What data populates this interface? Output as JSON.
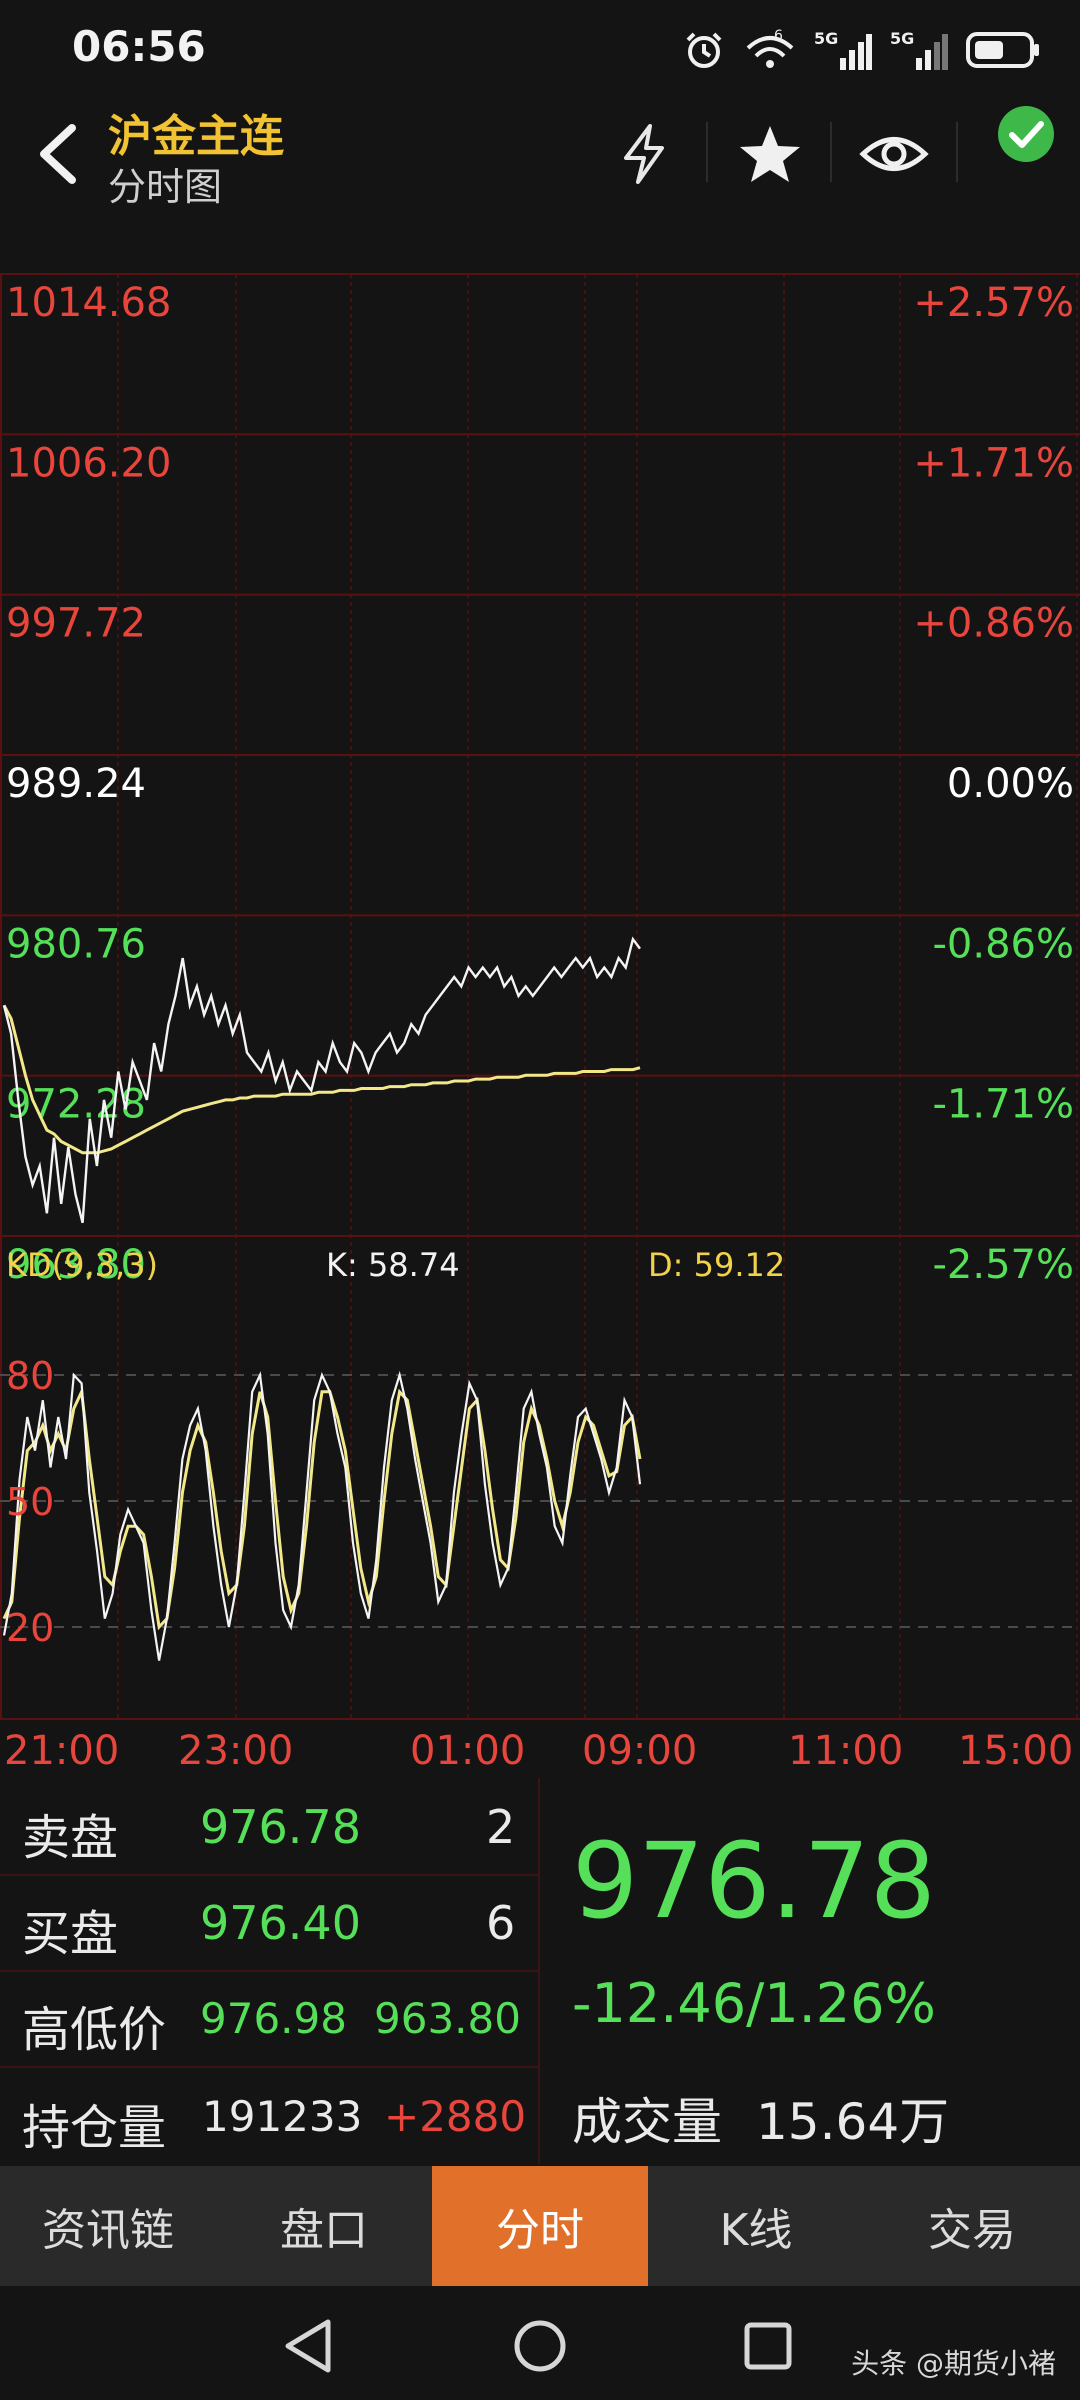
{
  "status_bar": {
    "time": "06:56",
    "icons": [
      "alarm-icon",
      "wifi-icon",
      "signal-5g-icon",
      "signal-5g-icon",
      "battery-icon"
    ],
    "signal_labels": [
      "5G",
      "5G"
    ],
    "wifi_label": "6"
  },
  "header": {
    "title": "沪金主连",
    "subtitle": "分时图",
    "buttons": [
      "flash-icon",
      "star-icon",
      "eye-icon",
      "check-icon"
    ]
  },
  "price_axis": {
    "left_labels": [
      "1014.68",
      "1006.20",
      "997.72",
      "989.24",
      "980.76",
      "972.28",
      "963.80"
    ],
    "right_labels": [
      "+2.57%",
      "+1.71%",
      "+0.86%",
      "0.00%",
      "-0.86%",
      "-1.71%",
      "-2.57%"
    ],
    "colors": {
      "up": "#e8463c",
      "flat": "#ffffff",
      "down": "#56e05a"
    }
  },
  "kd_indicator": {
    "label": "KD(9,3,3)",
    "k_text": "K: 58.74",
    "d_text": "D: 59.12",
    "levels": [
      "80",
      "50",
      "20"
    ]
  },
  "time_axis": [
    "21:00",
    "23:00",
    "01:00",
    "09:00",
    "11:00",
    "15:00"
  ],
  "chart_data": {
    "type": "line",
    "ylim": [
      963.8,
      1014.68
    ],
    "series": [
      {
        "values": [
          976.0,
          974.5,
          971.0,
          968.0,
          966.5,
          967.5,
          965.0,
          969.0,
          965.5,
          968.5,
          966.0,
          964.5,
          970.0,
          967.5,
          971.0,
          969.0,
          972.5,
          970.5,
          973.0,
          972.0,
          971.0,
          974.0,
          972.5,
          975.0,
          976.5,
          978.5,
          976.0,
          977.0,
          975.5,
          976.5,
          975.0,
          976.0,
          974.5,
          975.5,
          973.5,
          973.0,
          972.5,
          973.5,
          972.0,
          973.0,
          971.5,
          972.5,
          972.0,
          971.5,
          973.0,
          972.5,
          974.0,
          973.0,
          972.5,
          974.0,
          973.5,
          972.5,
          973.5,
          974.0,
          974.5,
          973.5,
          974.0,
          975.0,
          974.5,
          975.5,
          976.0,
          976.5,
          977.0,
          977.5,
          977.0,
          978.0,
          977.5,
          978.0,
          977.5,
          978.0,
          977.0,
          977.5,
          976.5,
          977.0,
          976.5,
          977.0,
          977.5,
          978.0,
          977.5,
          978.0,
          978.5,
          978.0,
          978.5,
          977.5,
          978.0,
          977.5,
          978.5,
          978.0,
          979.5,
          979.0
        ]
      },
      {
        "values": [
          976.0,
          975.3,
          973.8,
          972.3,
          971.0,
          970.2,
          969.4,
          969.2,
          968.8,
          968.6,
          968.4,
          968.2,
          968.2,
          968.2,
          968.3,
          968.4,
          968.6,
          968.8,
          969.0,
          969.2,
          969.4,
          969.6,
          969.8,
          970.0,
          970.2,
          970.4,
          970.5,
          970.6,
          970.7,
          970.8,
          970.9,
          971.0,
          971.0,
          971.1,
          971.1,
          971.2,
          971.2,
          971.2,
          971.2,
          971.3,
          971.3,
          971.3,
          971.3,
          971.3,
          971.4,
          971.4,
          971.4,
          971.5,
          971.5,
          971.5,
          971.6,
          971.6,
          971.6,
          971.6,
          971.7,
          971.7,
          971.7,
          971.8,
          971.8,
          971.8,
          971.9,
          971.9,
          971.9,
          972.0,
          972.0,
          972.0,
          972.1,
          972.1,
          972.1,
          972.2,
          972.2,
          972.2,
          972.2,
          972.3,
          972.3,
          972.3,
          972.3,
          972.4,
          972.4,
          972.4,
          972.4,
          972.5,
          972.5,
          972.5,
          972.5,
          972.6,
          972.6,
          972.6,
          972.6,
          972.7
        ]
      }
    ]
  },
  "kd_data": {
    "k": [
      18,
      28,
      55,
      70,
      62,
      74,
      58,
      70,
      60,
      80,
      78,
      52,
      38,
      22,
      28,
      42,
      48,
      44,
      40,
      24,
      12,
      22,
      40,
      60,
      68,
      72,
      62,
      44,
      30,
      20,
      30,
      52,
      76,
      80,
      66,
      40,
      24,
      20,
      30,
      52,
      74,
      80,
      76,
      66,
      58,
      40,
      28,
      22,
      36,
      58,
      74,
      80,
      72,
      60,
      50,
      40,
      26,
      30,
      52,
      66,
      78,
      74,
      54,
      40,
      30,
      34,
      52,
      72,
      76,
      66,
      58,
      44,
      40,
      56,
      70,
      72,
      66,
      60,
      52,
      58,
      74,
      70,
      54
    ],
    "d": [
      22,
      26,
      46,
      62,
      64,
      68,
      62,
      66,
      62,
      72,
      76,
      60,
      46,
      32,
      30,
      38,
      44,
      44,
      42,
      32,
      20,
      22,
      34,
      52,
      62,
      68,
      64,
      52,
      38,
      28,
      30,
      44,
      66,
      76,
      70,
      50,
      32,
      24,
      28,
      44,
      64,
      76,
      76,
      70,
      62,
      48,
      34,
      26,
      32,
      50,
      66,
      76,
      74,
      64,
      54,
      44,
      32,
      30,
      44,
      58,
      72,
      74,
      62,
      48,
      36,
      34,
      46,
      64,
      72,
      68,
      60,
      50,
      44,
      52,
      64,
      70,
      68,
      62,
      56,
      57,
      68,
      70,
      60
    ]
  },
  "quote_panel": {
    "sell_label": "卖盘",
    "sell_price": "976.78",
    "sell_qty": "2",
    "buy_label": "买盘",
    "buy_price": "976.40",
    "buy_qty": "6",
    "hilo_label": "高低价",
    "high": "976.98",
    "low": "963.80",
    "oi_label": "持仓量",
    "oi_value": "191233",
    "oi_change": "+2880"
  },
  "price_panel": {
    "last_price": "976.78",
    "change": "-12.46/1.26%",
    "volume_label": "成交量",
    "volume_value": "15.64万"
  },
  "tabs": [
    "资讯链",
    "盘口",
    "分时",
    "K线",
    "交易"
  ],
  "active_tab": 2,
  "nav": [
    "back-triangle-icon",
    "home-circle-icon",
    "recents-square-icon"
  ],
  "watermark": "头条 @期货小褚"
}
